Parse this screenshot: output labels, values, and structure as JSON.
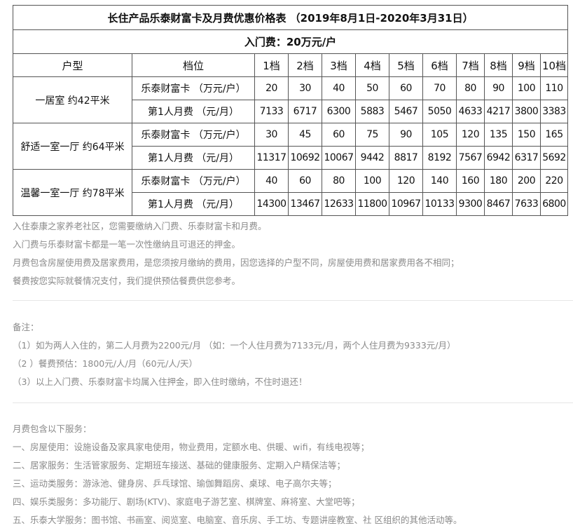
{
  "table": {
    "title": "长住产品乐泰财富卡及月费优惠价格表 （2019年8月1日-2020年3月31日）",
    "entry_fee": "入门费：20万元/户",
    "header": {
      "type_label": "户型",
      "tier_label": "档位",
      "tiers": [
        "1档",
        "2档",
        "3档",
        "4档",
        "5档",
        "6档",
        "7档",
        "8档",
        "9档",
        "10档"
      ]
    },
    "groups": [
      {
        "name": "一居室 约42平米",
        "card_label": "乐泰财富卡 （万元/户）",
        "fee_label": "第1人月费 （元/月）",
        "card": [
          "20",
          "30",
          "40",
          "50",
          "60",
          "70",
          "80",
          "90",
          "100",
          "110"
        ],
        "fee": [
          "7133",
          "6717",
          "6300",
          "5883",
          "5467",
          "5050",
          "4633",
          "4217",
          "3800",
          "3383"
        ]
      },
      {
        "name": "舒适一室一厅 约64平米",
        "card_label": "乐泰财富卡 （万元/户）",
        "fee_label": "第1人月费 （元/月）",
        "card": [
          "30",
          "45",
          "60",
          "75",
          "90",
          "105",
          "120",
          "135",
          "150",
          "165"
        ],
        "fee": [
          "11317",
          "10692",
          "10067",
          "9442",
          "8817",
          "8192",
          "7567",
          "6942",
          "6317",
          "5692"
        ]
      },
      {
        "name": "温馨一室一厅 约78平米",
        "card_label": "乐泰财富卡 （万元/户）",
        "fee_label": "第1人月费 （元/月）",
        "card": [
          "40",
          "60",
          "80",
          "100",
          "120",
          "140",
          "160",
          "180",
          "200",
          "220"
        ],
        "fee": [
          "14300",
          "13467",
          "12633",
          "11800",
          "10967",
          "10133",
          "9300",
          "8467",
          "7633",
          "6800"
        ]
      }
    ]
  },
  "intro": [
    "入住泰康之家养老社区，您需要缴纳入门费、乐泰财富卡和月费。",
    "入门费与乐泰财富卡都是一笔一次性缴纳且可退还的押金。",
    "月费包含房屋使用费及居家费用，是您须按月缴纳的费用，因您选择的户型不同，房屋使用费和居家费用各不相同；",
    "餐费按您实际就餐情况支付，我们提供预估餐费供您参考。"
  ],
  "remarks": {
    "title": "备注：",
    "items": [
      "（1）如为两人入住的，第二人月费为2200元/月 （如：一个人住月费为7133元/月，两个人住月费为9333元/月）",
      "（2 ）餐费预估：1800元/人/月（60元/人/天）",
      "（3）以上入门费、乐泰财富卡均属入住押金，即入住时缴纳，不住时退还！"
    ]
  },
  "services": {
    "title": "月费包含以下服务：",
    "items": [
      "一、房屋使用：设施设备及家具家电使用，物业费用，定额水电、供暖、wifi，有线电视等；",
      "二、居家服务：生活管家服务、定期班车接送、基础的健康服务、定期入户精保洁等；",
      "三、运动类服务：游泳池、健身房、乒乓球馆、瑜伽舞蹈房、桌球、电子高尔夫等；",
      "四、娱乐类服务：多功能厅、剧场(KTV)、家庭电子游艺室、棋牌室、麻将室、大堂吧等；",
      "五、乐泰大学服务：图书馆、书画室、阅览室、电脑室、音乐房、手工坊、专题讲座教室、社 区组织的其他活动等。"
    ]
  }
}
